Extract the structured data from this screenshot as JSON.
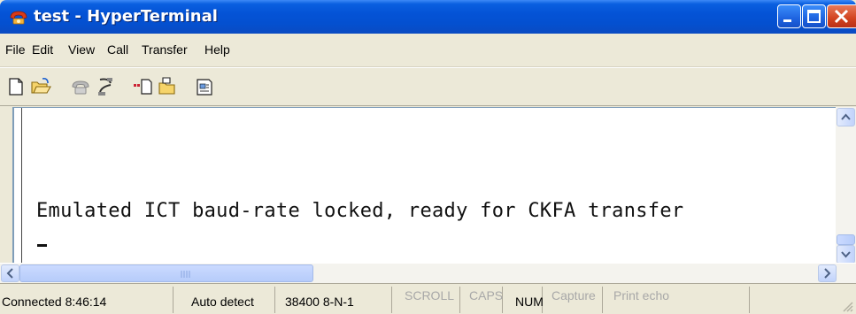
{
  "window": {
    "title": "test - HyperTerminal",
    "icon": "hyperterminal-phone-icon",
    "controls": [
      "minimize-icon",
      "maximize-icon",
      "close-icon"
    ]
  },
  "menu": [
    "File",
    "Edit",
    "View",
    "Call",
    "Transfer",
    "Help"
  ],
  "toolbar": [
    "new-connection-icon",
    "open-icon",
    "call-icon",
    "disconnect-icon",
    "send-icon",
    "receive-icon",
    "properties-icon"
  ],
  "terminal": {
    "line": "Emulated ICT baud-rate locked, ready for CKFA transfer"
  },
  "status": {
    "connected": "Connected 8:46:14",
    "detect": "Auto detect",
    "port": "38400 8-N-1",
    "scroll": "SCROLL",
    "caps": "CAPS",
    "num": "NUM",
    "capture": "Capture",
    "print_echo": "Print echo"
  },
  "colors": {
    "titlebar": "#0453d6",
    "close": "#d2431f",
    "face": "#ece9d8"
  }
}
